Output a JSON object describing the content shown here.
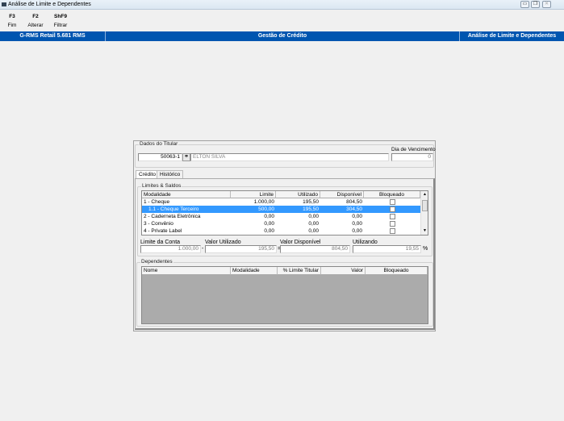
{
  "window": {
    "title": "Análise de Limite e Dependentes",
    "controls": [
      "minimize",
      "restore",
      "close"
    ]
  },
  "toolbar": [
    {
      "key": "F3",
      "label": "Fim"
    },
    {
      "key": "F2",
      "label": "Alterar"
    },
    {
      "key": "ShF9",
      "label": "Filtrar"
    }
  ],
  "header": {
    "app": "G-RMS Retail 5.681 RMS",
    "module": "Gestão de Crédito",
    "screen": "Análise de Limite e Dependentes"
  },
  "titular": {
    "group_label": "Dados do Titular",
    "code": "50063-1",
    "name": "ELTON SILVA",
    "due_day_label": "Dia de Vencimento",
    "due_day": "0"
  },
  "tabs": [
    {
      "label": "Crédito",
      "active": true
    },
    {
      "label": "Histórico",
      "active": false
    }
  ],
  "limits": {
    "group_label": "Limites & Saldos",
    "columns": [
      "Modalidade",
      "Limite",
      "Utilizado",
      "Disponível",
      "Bloqueado"
    ],
    "rows": [
      {
        "modalidade": "1 - Cheque",
        "limite": "1.000,00",
        "utilizado": "195,50",
        "disponivel": "804,50",
        "bloqueado": false
      },
      {
        "modalidade": "1.1 - Cheque Terceiro",
        "limite": "500,00",
        "utilizado": "195,50",
        "disponivel": "304,50",
        "bloqueado": false,
        "selected": true
      },
      {
        "modalidade": "2 - Caderneta Eletrônica",
        "limite": "0,00",
        "utilizado": "0,00",
        "disponivel": "0,00",
        "bloqueado": false
      },
      {
        "modalidade": "3 - Convênio",
        "limite": "0,00",
        "utilizado": "0,00",
        "disponivel": "0,00",
        "bloqueado": false
      },
      {
        "modalidade": "4 - Private Label",
        "limite": "0,00",
        "utilizado": "0,00",
        "disponivel": "0,00",
        "bloqueado": false
      }
    ]
  },
  "totals": {
    "limite_label": "Limite da Conta",
    "limite": "1.000,00",
    "utilizado_label": "Valor Utilizado",
    "utilizado": "195,50",
    "disponivel_label": "Valor Disponível",
    "disponivel": "804,50",
    "utilizando_label": "Utilizando",
    "utilizando": "19,55",
    "percent": "%",
    "minus": "-",
    "equals": "="
  },
  "dependentes": {
    "group_label": "Dependentes",
    "columns": [
      "Nome",
      "Modalidade",
      "% Limite Titular",
      "Valor",
      "Bloqueado"
    ]
  }
}
